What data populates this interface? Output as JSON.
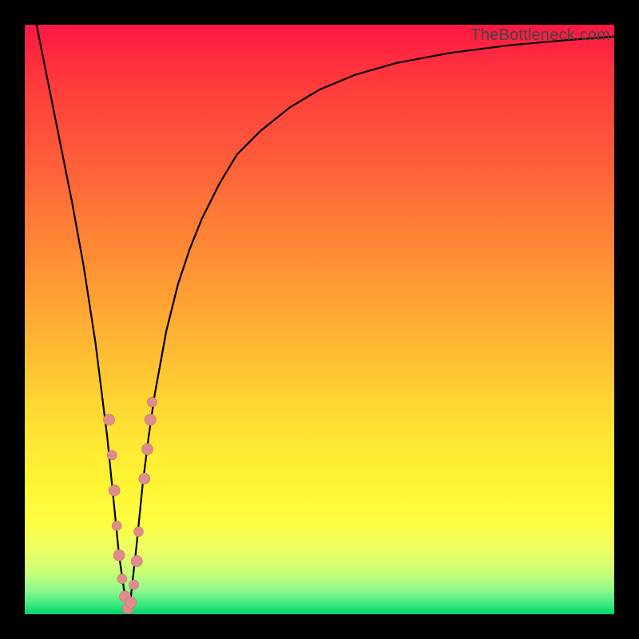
{
  "watermark": "TheBottleneck.com",
  "colors": {
    "frame": "#000000",
    "curve": "#000000",
    "marker_fill": "#e08c8c",
    "marker_stroke": "#c46f6f"
  },
  "chart_data": {
    "type": "line",
    "title": "",
    "xlabel": "",
    "ylabel": "",
    "xlim": [
      0,
      100
    ],
    "ylim": [
      0,
      100
    ],
    "series": [
      {
        "name": "bottleneck-curve",
        "x": [
          0,
          2,
          4,
          6,
          8,
          10,
          12,
          14,
          15,
          16,
          17,
          17.5,
          18,
          19,
          20,
          21,
          22,
          24,
          26,
          28,
          30,
          33,
          36,
          40,
          45,
          50,
          56,
          63,
          72,
          82,
          92,
          100
        ],
        "y": [
          108,
          100,
          90,
          80,
          70,
          59,
          46,
          30,
          20,
          10,
          3,
          0,
          3,
          12,
          22,
          30,
          37,
          48,
          56,
          62,
          67,
          73,
          78,
          82,
          86,
          89,
          91.5,
          93.5,
          95.2,
          96.5,
          97.4,
          98
        ]
      }
    ],
    "markers": [
      {
        "x": 14.3,
        "y": 33,
        "r": 7
      },
      {
        "x": 14.8,
        "y": 27,
        "r": 6
      },
      {
        "x": 15.2,
        "y": 21,
        "r": 7
      },
      {
        "x": 15.6,
        "y": 15,
        "r": 6
      },
      {
        "x": 16.0,
        "y": 10,
        "r": 7
      },
      {
        "x": 16.5,
        "y": 6,
        "r": 6
      },
      {
        "x": 17.0,
        "y": 3,
        "r": 7
      },
      {
        "x": 17.5,
        "y": 1,
        "r": 7
      },
      {
        "x": 18.0,
        "y": 2,
        "r": 7
      },
      {
        "x": 18.5,
        "y": 5,
        "r": 6
      },
      {
        "x": 19.0,
        "y": 9,
        "r": 7
      },
      {
        "x": 19.3,
        "y": 14,
        "r": 6
      },
      {
        "x": 20.3,
        "y": 23,
        "r": 7
      },
      {
        "x": 20.8,
        "y": 28,
        "r": 7
      },
      {
        "x": 21.3,
        "y": 33,
        "r": 7
      },
      {
        "x": 21.6,
        "y": 36,
        "r": 6
      }
    ]
  }
}
